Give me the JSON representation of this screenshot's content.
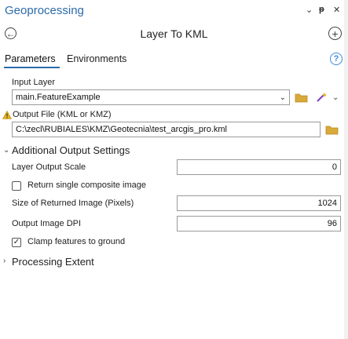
{
  "pane": {
    "title": "Geoprocessing",
    "menu_glyph": "⌄",
    "pin_glyph": "ᵽ",
    "close_glyph": "✕"
  },
  "tool": {
    "title": "Layer To KML",
    "back_glyph": "←",
    "add_glyph": "+"
  },
  "tabs": {
    "parameters": "Parameters",
    "environments": "Environments",
    "help_glyph": "?"
  },
  "params": {
    "input_layer_label": "Input Layer",
    "input_layer_value": "main.FeatureExample",
    "dropdown_glyph": "⌄",
    "output_file_label": "Output File (KML or KMZ)",
    "output_file_value": "C:\\zecl\\RUBIALES\\KMZ\\Geotecnia\\test_arcgis_pro.kml"
  },
  "additional": {
    "header": "Additional Output Settings",
    "layer_output_scale_label": "Layer Output Scale",
    "layer_output_scale_value": "0",
    "return_single_label": "Return single composite image",
    "return_single_checked": false,
    "size_label": "Size of Returned Image (Pixels)",
    "size_value": "1024",
    "dpi_label": "Output Image DPI",
    "dpi_value": "96",
    "clamp_label": "Clamp features to ground",
    "clamp_checked": true,
    "check_glyph": "✓"
  },
  "processing_extent": {
    "header": "Processing Extent"
  },
  "colors": {
    "accent": "#2c6aa9",
    "folder": "#d9a93a",
    "warning": "#e8b21f",
    "wand": "#7a3cc8"
  }
}
